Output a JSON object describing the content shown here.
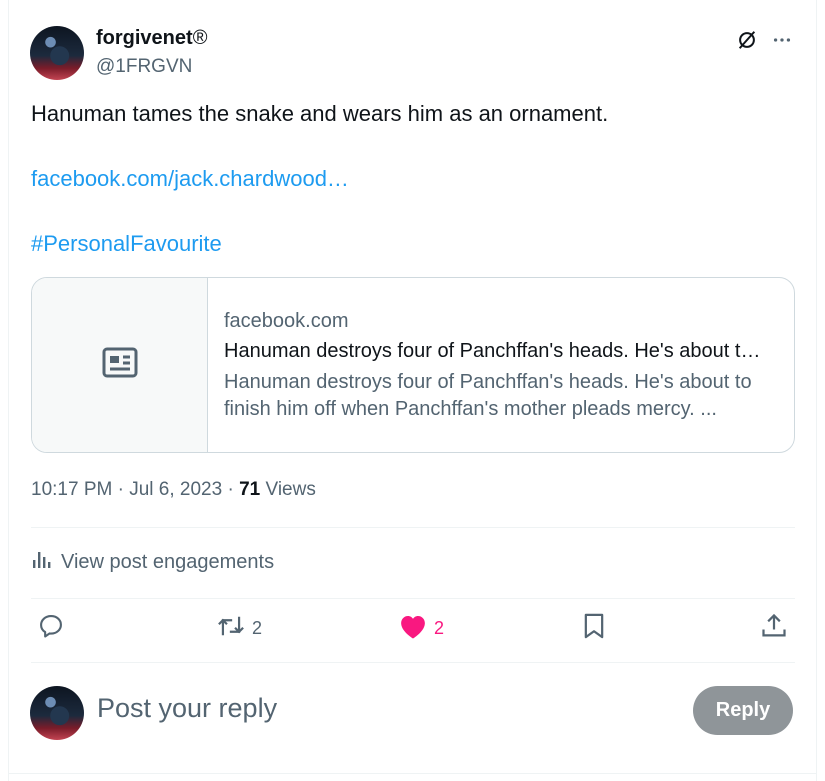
{
  "post": {
    "display_name": "forgivenet",
    "verified_mark": "®",
    "handle": "@1FRGVN",
    "text": "Hanuman tames the snake and wears him as an ornament.",
    "link_text": "facebook.com/jack.chardwood…",
    "hashtag": "#PersonalFavourite"
  },
  "card": {
    "domain": "facebook.com",
    "title": "Hanuman destroys four of Panchffan's heads. He's about t…",
    "description": "Hanuman destroys four of Panchffan's heads. He's about to finish him off when Panchffan's mother pleads mercy. ..."
  },
  "meta": {
    "time": "10:17 PM",
    "sep1": "·",
    "date": "Jul 6, 2023",
    "sep2": "·",
    "views_count": "71",
    "views_label": "Views"
  },
  "engagements_label": "View post engagements",
  "actions": {
    "reply_count": "",
    "repost_count": "2",
    "like_count": "2"
  },
  "composer": {
    "placeholder": "Post your reply",
    "reply_button": "Reply"
  },
  "colors": {
    "accent": "#1d9bf0",
    "like": "#f91880",
    "muted": "#536471",
    "reply_button_disabled": "#8f9599"
  },
  "icons": [
    "grok-icon",
    "more-icon",
    "article-icon",
    "bar-chart-icon",
    "reply-icon",
    "repost-icon",
    "heart-icon",
    "bookmark-icon",
    "share-icon"
  ]
}
